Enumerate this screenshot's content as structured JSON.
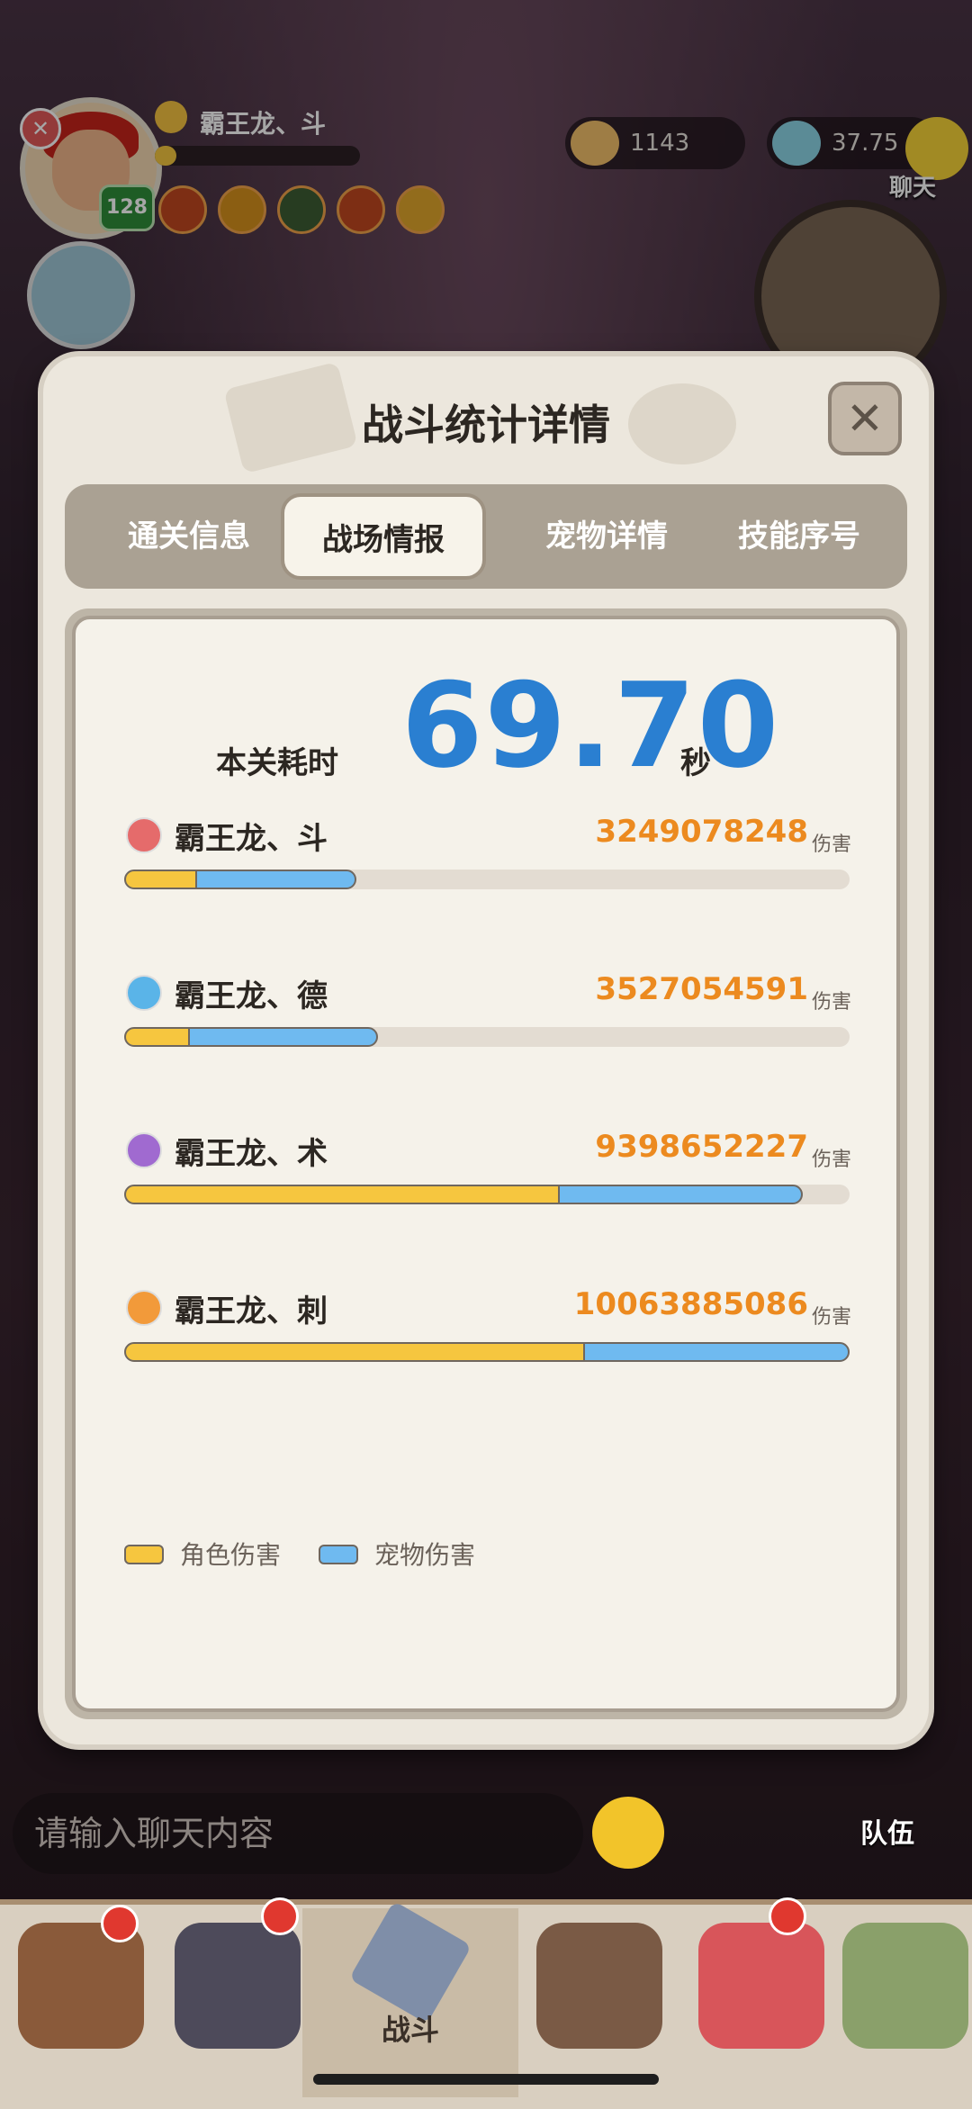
{
  "hud": {
    "player_name": "霸王龙、斗",
    "level": "128",
    "gold": "1143",
    "diamond": "37.75",
    "chat_label": "聊天"
  },
  "modal": {
    "title": "战斗统计详情",
    "tabs": [
      "通关信息",
      "战场情报",
      "宠物详情",
      "技能序号"
    ],
    "active_tab": "战场情报",
    "time_label": "本关耗时",
    "time_value": "69.70",
    "time_unit": "秒",
    "damage_unit": "伤害",
    "rows": [
      {
        "name": "霸王龙、斗",
        "damage": "3249078248",
        "role_fraction": 0.1,
        "total_fraction": 0.32,
        "icon": "warrior-class-icon",
        "icon_color": "#e56b6b"
      },
      {
        "name": "霸王龙、德",
        "damage": "3527054591",
        "role_fraction": 0.09,
        "total_fraction": 0.35,
        "icon": "druid-class-icon",
        "icon_color": "#5ab4e8"
      },
      {
        "name": "霸王龙、术",
        "damage": "9398652227",
        "role_fraction": 0.6,
        "total_fraction": 0.935,
        "icon": "warlock-class-icon",
        "icon_color": "#a06ad0"
      },
      {
        "name": "霸王龙、刺",
        "damage": "10063885086",
        "role_fraction": 0.635,
        "total_fraction": 1.0,
        "icon": "assassin-class-icon",
        "icon_color": "#f29a3a"
      }
    ],
    "legend": {
      "role": "角色伤害",
      "pet": "宠物伤害"
    },
    "colors": {
      "role": "#f6c63f",
      "pet": "#6fbaf0",
      "time": "#2a7fd1",
      "damage": "#ec8a1f"
    }
  },
  "chat": {
    "placeholder": "请输入聊天内容",
    "team_label": "队伍"
  },
  "nav": {
    "battle_label": "战斗"
  }
}
